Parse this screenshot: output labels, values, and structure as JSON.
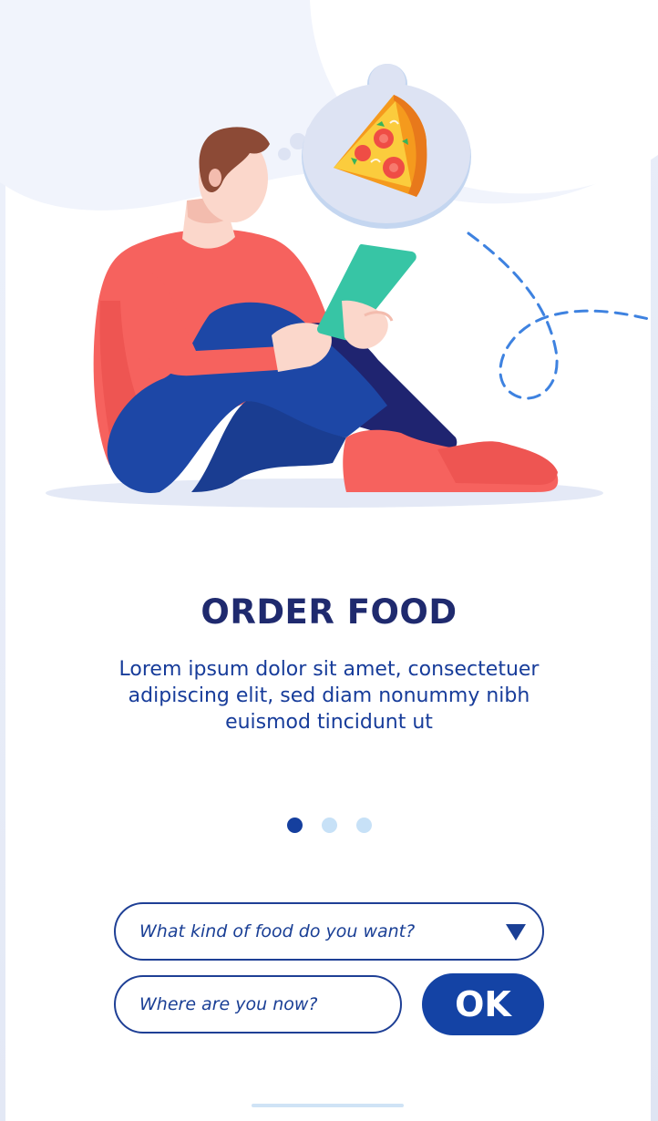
{
  "onboarding": {
    "title": "ORDER FOOD",
    "description": "Lorem ipsum dolor sit amet, consectetuer adipiscing elit, sed diam nonummy nibh euismod tincidunt ut",
    "pagination": {
      "total": 3,
      "active_index": 0
    }
  },
  "form": {
    "food_select_placeholder": "What kind of food do you want?",
    "location_placeholder": "Where are you now?",
    "ok_label": "OK"
  },
  "icons": {
    "dropdown": "triangle-down-icon",
    "illustration": "person-reading-tablet-thinking-pizza"
  },
  "colors": {
    "primary": "#1443a5",
    "title": "#1f2a6e",
    "text": "#173c9a",
    "dot_active": "#153f9e",
    "dot_inactive": "#c7e1f7",
    "shirt": "#f6625e",
    "pants": "#1d47a6",
    "tablet": "#37c5a5",
    "hair": "#8c4a36"
  }
}
